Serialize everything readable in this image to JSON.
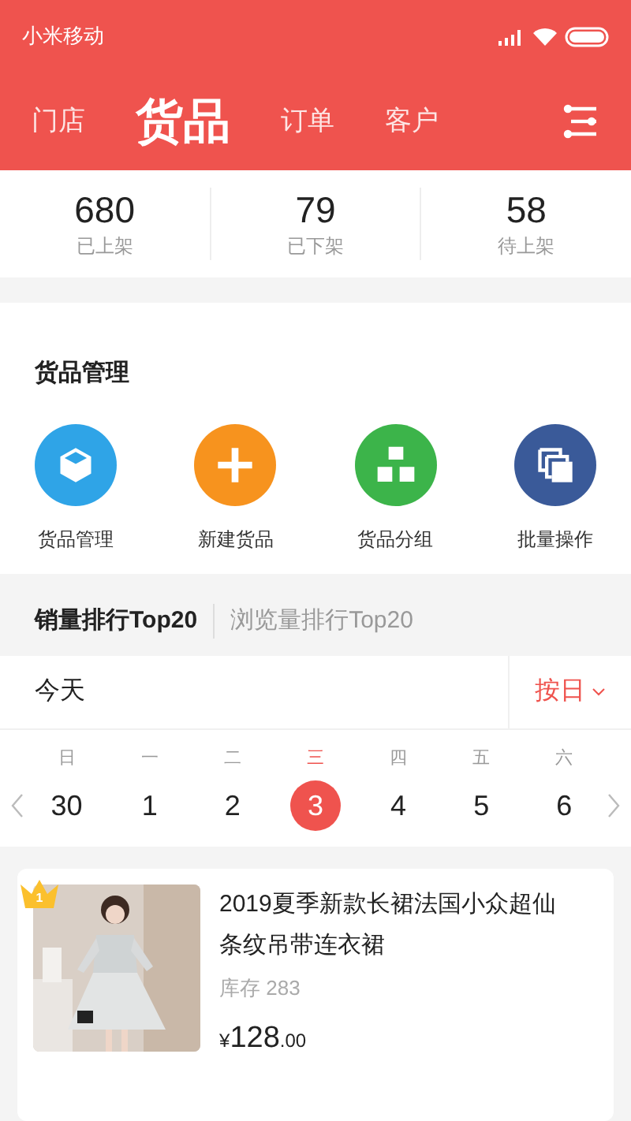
{
  "status_bar": {
    "carrier": "小米移动"
  },
  "nav_tabs": [
    {
      "label": "门店",
      "selected": false
    },
    {
      "label": "货品",
      "selected": true
    },
    {
      "label": "订单",
      "selected": false
    },
    {
      "label": "客户",
      "selected": false
    }
  ],
  "stats": [
    {
      "value": "680",
      "label": "已上架"
    },
    {
      "value": "79",
      "label": "已下架"
    },
    {
      "value": "58",
      "label": "待上架"
    }
  ],
  "management": {
    "title": "货品管理",
    "actions": [
      {
        "label": "货品管理",
        "kind": "cube",
        "color": "#2fa4e7"
      },
      {
        "label": "新建货品",
        "kind": "plus",
        "color": "#f7931e"
      },
      {
        "label": "货品分组",
        "kind": "cubes",
        "color": "#3cb44a"
      },
      {
        "label": "批量操作",
        "kind": "copies",
        "color": "#3a5a99"
      }
    ]
  },
  "ranking_tabs": [
    {
      "label": "销量排行Top20",
      "selected": true
    },
    {
      "label": "浏览量排行Top20",
      "selected": false
    }
  ],
  "period": {
    "label": "今天",
    "mode": "按日"
  },
  "week": [
    {
      "weekday": "日",
      "date": "30",
      "selected": false
    },
    {
      "weekday": "一",
      "date": "1",
      "selected": false
    },
    {
      "weekday": "二",
      "date": "2",
      "selected": false
    },
    {
      "weekday": "三",
      "date": "3",
      "selected": true
    },
    {
      "weekday": "四",
      "date": "4",
      "selected": false
    },
    {
      "weekday": "五",
      "date": "5",
      "selected": false
    },
    {
      "weekday": "六",
      "date": "6",
      "selected": false
    }
  ],
  "products": [
    {
      "rank": "1",
      "title": "2019夏季新款长裙法国小众超仙条纹吊带连衣裙",
      "stock": "库存 283",
      "currency": "¥",
      "price": "128",
      "cents": ".00"
    }
  ]
}
